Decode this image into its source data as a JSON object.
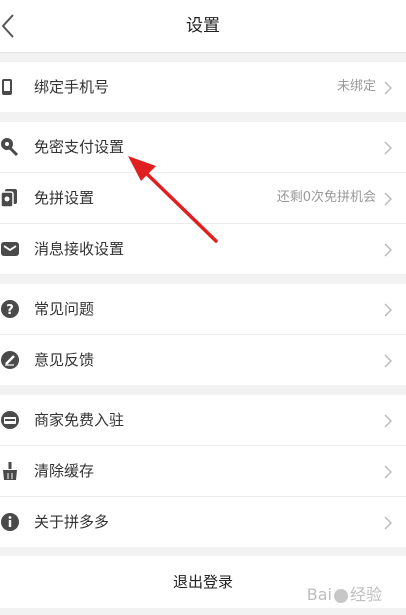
{
  "header": {
    "title": "设置"
  },
  "groups": [
    {
      "items": [
        {
          "label": "绑定手机号",
          "value": "未绑定",
          "icon": "phone-icon"
        }
      ]
    },
    {
      "items": [
        {
          "label": "免密支付设置",
          "value": "",
          "icon": "key-icon"
        },
        {
          "label": "免拼设置",
          "value": "还剩0次免拼机会",
          "icon": "free-group-icon"
        },
        {
          "label": "消息接收设置",
          "value": "",
          "icon": "mail-icon"
        }
      ]
    },
    {
      "items": [
        {
          "label": "常见问题",
          "value": "",
          "icon": "question-icon"
        },
        {
          "label": "意见反馈",
          "value": "",
          "icon": "pencil-icon"
        }
      ]
    },
    {
      "items": [
        {
          "label": "商家免费入驻",
          "value": "",
          "icon": "store-icon"
        },
        {
          "label": "清除缓存",
          "value": "",
          "icon": "broom-icon"
        },
        {
          "label": "关于拼多多",
          "value": "",
          "icon": "info-icon"
        }
      ]
    }
  ],
  "logout": {
    "label": "退出登录"
  },
  "watermark": {
    "text": "Bai",
    "suffix": "经验"
  },
  "colors": {
    "icon": "#4a4a4a",
    "arrow": "#e02020",
    "chevron": "#bbbbbb"
  }
}
